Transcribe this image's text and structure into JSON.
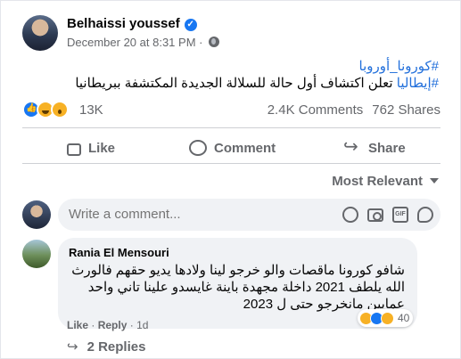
{
  "post": {
    "author": "Belhaissi youssef",
    "timestamp": "December 20 at 8:31 PM",
    "separator": "·",
    "hashtag_1": "#كورونا_أوروبا",
    "hashtag_2": "#إيطاليا",
    "body": " تعلن اكتشاف أول حالة للسلالة الجديدة المكتشفة  ببريطانيا"
  },
  "reactions": {
    "count": "13K",
    "comments": "2.4K Comments",
    "shares": "762 Shares",
    "icons": [
      "like-icon",
      "haha-icon",
      "wow-icon"
    ]
  },
  "actions": {
    "like": "Like",
    "comment": "Comment",
    "share": "Share"
  },
  "sort": {
    "label": "Most Relevant"
  },
  "composer": {
    "placeholder": "Write a comment...",
    "tools": [
      "emoji-icon",
      "camera-icon",
      "gif-icon",
      "sticker-icon"
    ],
    "gif_label": "GIF"
  },
  "comment": {
    "author": "Rania El Mensouri",
    "text": "شافو كورونا ماقصات والو خرجو لينا ولادها يديو حقهم فالورث الله يلطف 2021 داخلة مجهدة باينة غايسدو علينا تاني واحد عمايين مانخرجو حتى ل 2023",
    "reaction_count": "40",
    "like": "Like",
    "dot": "·",
    "reply": "Reply",
    "age": "1d",
    "replies": "2 Replies"
  },
  "colors": {
    "accent": "#1877f2",
    "hashtag": "#216fdb",
    "muted": "#65676b",
    "bubble": "#f0f2f5"
  }
}
